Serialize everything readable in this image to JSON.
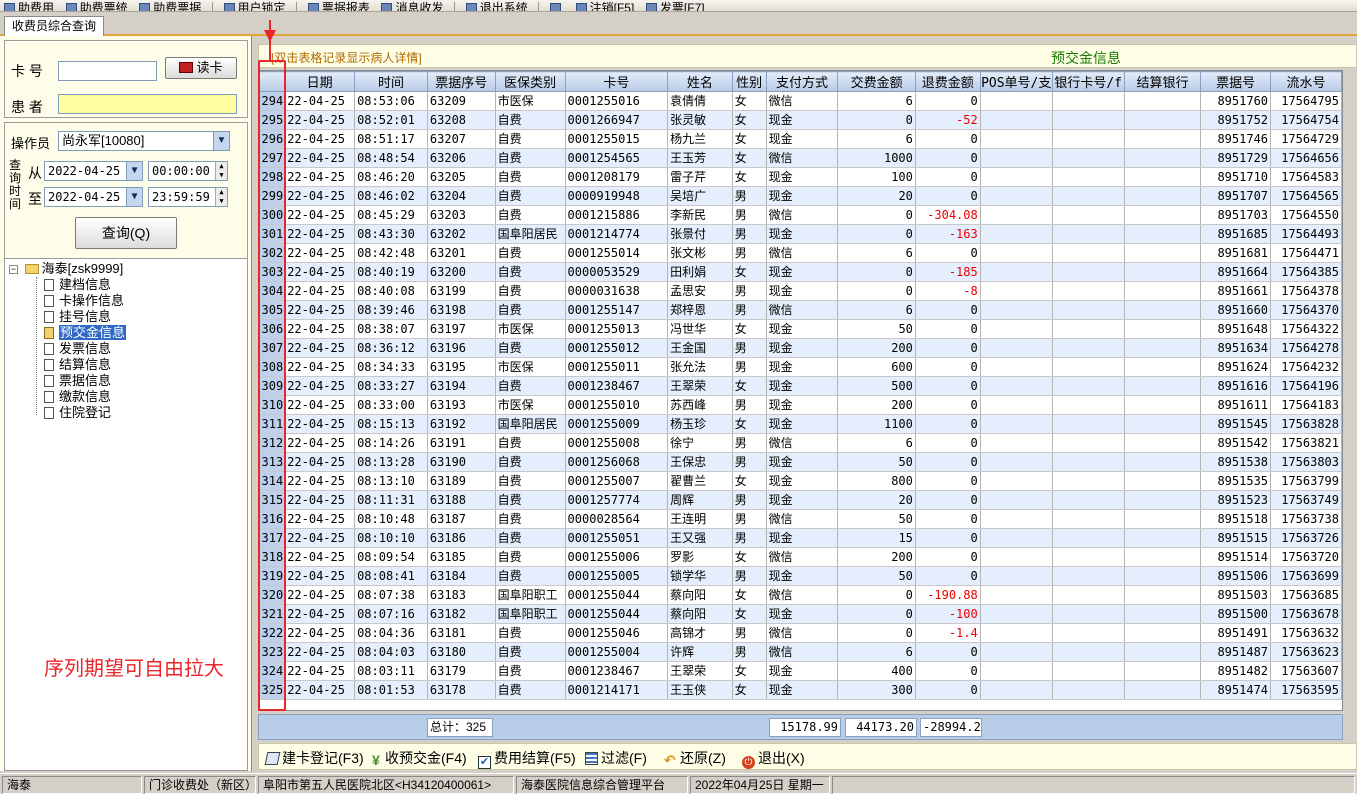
{
  "toolbar": {
    "items": [
      "助费用",
      "助费票统",
      "助费票据",
      "用户锁定",
      "票据报表",
      "消息收发",
      "退出系统",
      "",
      "注销[F5]",
      "发票[F7]"
    ]
  },
  "tabs": [
    {
      "label": "收费员综合查询"
    }
  ],
  "left": {
    "card_label": "卡  号",
    "card_value": "",
    "read_card_label": "读卡",
    "patient_label": "患  者",
    "patient_value": "",
    "operator_label": "操作员",
    "operator_value": "尚永军[10080]",
    "query_time_label": "查询时间",
    "from_label": "从",
    "to_label": "至",
    "from_date": "2022-04-25",
    "from_time": "00:00:00",
    "to_date": "2022-04-25",
    "to_time": "23:59:59",
    "query_button": "查询(Q)"
  },
  "tree": {
    "root": "海泰[zsk9999]",
    "items": [
      "建档信息",
      "卡操作信息",
      "挂号信息",
      "预交金信息",
      "发票信息",
      "结算信息",
      "票据信息",
      "缴款信息",
      "住院登记"
    ],
    "selected": "预交金信息"
  },
  "grid": {
    "hint": "[双击表格记录显示病人详情]",
    "title": "预交金信息",
    "columns": [
      "",
      "日期",
      "时间",
      "票据序号",
      "医保类别",
      "卡号",
      "姓名",
      "性别",
      "支付方式",
      "交费金额",
      "退费金额",
      "POS单号/支",
      "银行卡号/f",
      "结算银行",
      "票据号",
      "流水号"
    ],
    "rows": [
      [
        "294",
        "22-04-25",
        "08:53:06",
        "63209",
        "市医保",
        "0001255016",
        "袁倩倩",
        "女",
        "微信",
        "6",
        "0",
        "",
        "",
        "",
        "8951760",
        "17564795"
      ],
      [
        "295",
        "22-04-25",
        "08:52:01",
        "63208",
        "自费",
        "0001266947",
        "张灵敏",
        "女",
        "现金",
        "0",
        "-52",
        "",
        "",
        "",
        "8951752",
        "17564754"
      ],
      [
        "296",
        "22-04-25",
        "08:51:17",
        "63207",
        "自费",
        "0001255015",
        "杨九兰",
        "女",
        "现金",
        "6",
        "0",
        "",
        "",
        "",
        "8951746",
        "17564729"
      ],
      [
        "297",
        "22-04-25",
        "08:48:54",
        "63206",
        "自费",
        "0001254565",
        "王玉芳",
        "女",
        "微信",
        "1000",
        "0",
        "",
        "",
        "",
        "8951729",
        "17564656"
      ],
      [
        "298",
        "22-04-25",
        "08:46:20",
        "63205",
        "自费",
        "0001208179",
        "雷子芹",
        "女",
        "现金",
        "100",
        "0",
        "",
        "",
        "",
        "8951710",
        "17564583"
      ],
      [
        "299",
        "22-04-25",
        "08:46:02",
        "63204",
        "自费",
        "0000919948",
        "吴培广",
        "男",
        "现金",
        "20",
        "0",
        "",
        "",
        "",
        "8951707",
        "17564565"
      ],
      [
        "300",
        "22-04-25",
        "08:45:29",
        "63203",
        "自费",
        "0001215886",
        "李新民",
        "男",
        "微信",
        "0",
        "-304.08",
        "",
        "",
        "",
        "8951703",
        "17564550"
      ],
      [
        "301",
        "22-04-25",
        "08:43:30",
        "63202",
        "国阜阳居民",
        "0001214774",
        "张景付",
        "男",
        "现金",
        "0",
        "-163",
        "",
        "",
        "",
        "8951685",
        "17564493"
      ],
      [
        "302",
        "22-04-25",
        "08:42:48",
        "63201",
        "自费",
        "0001255014",
        "张文彬",
        "男",
        "微信",
        "6",
        "0",
        "",
        "",
        "",
        "8951681",
        "17564471"
      ],
      [
        "303",
        "22-04-25",
        "08:40:19",
        "63200",
        "自费",
        "0000053529",
        "田利娟",
        "女",
        "现金",
        "0",
        "-185",
        "",
        "",
        "",
        "8951664",
        "17564385"
      ],
      [
        "304",
        "22-04-25",
        "08:40:08",
        "63199",
        "自费",
        "0000031638",
        "孟思安",
        "男",
        "现金",
        "0",
        "-8",
        "",
        "",
        "",
        "8951661",
        "17564378"
      ],
      [
        "305",
        "22-04-25",
        "08:39:46",
        "63198",
        "自费",
        "0001255147",
        "郑梓恩",
        "男",
        "微信",
        "6",
        "0",
        "",
        "",
        "",
        "8951660",
        "17564370"
      ],
      [
        "306",
        "22-04-25",
        "08:38:07",
        "63197",
        "市医保",
        "0001255013",
        "冯世华",
        "女",
        "现金",
        "50",
        "0",
        "",
        "",
        "",
        "8951648",
        "17564322"
      ],
      [
        "307",
        "22-04-25",
        "08:36:12",
        "63196",
        "自费",
        "0001255012",
        "王金国",
        "男",
        "现金",
        "200",
        "0",
        "",
        "",
        "",
        "8951634",
        "17564278"
      ],
      [
        "308",
        "22-04-25",
        "08:34:33",
        "63195",
        "市医保",
        "0001255011",
        "张允法",
        "男",
        "现金",
        "600",
        "0",
        "",
        "",
        "",
        "8951624",
        "17564232"
      ],
      [
        "309",
        "22-04-25",
        "08:33:27",
        "63194",
        "自费",
        "0001238467",
        "王翠荣",
        "女",
        "现金",
        "500",
        "0",
        "",
        "",
        "",
        "8951616",
        "17564196"
      ],
      [
        "310",
        "22-04-25",
        "08:33:00",
        "63193",
        "市医保",
        "0001255010",
        "苏西峰",
        "男",
        "现金",
        "200",
        "0",
        "",
        "",
        "",
        "8951611",
        "17564183"
      ],
      [
        "311",
        "22-04-25",
        "08:15:13",
        "63192",
        "国阜阳居民",
        "0001255009",
        "杨玉珍",
        "女",
        "现金",
        "1100",
        "0",
        "",
        "",
        "",
        "8951545",
        "17563828"
      ],
      [
        "312",
        "22-04-25",
        "08:14:26",
        "63191",
        "自费",
        "0001255008",
        "徐宁",
        "男",
        "微信",
        "6",
        "0",
        "",
        "",
        "",
        "8951542",
        "17563821"
      ],
      [
        "313",
        "22-04-25",
        "08:13:28",
        "63190",
        "自费",
        "0001256068",
        "王保忠",
        "男",
        "现金",
        "50",
        "0",
        "",
        "",
        "",
        "8951538",
        "17563803"
      ],
      [
        "314",
        "22-04-25",
        "08:13:10",
        "63189",
        "自费",
        "0001255007",
        "翟曹兰",
        "女",
        "现金",
        "800",
        "0",
        "",
        "",
        "",
        "8951535",
        "17563799"
      ],
      [
        "315",
        "22-04-25",
        "08:11:31",
        "63188",
        "自费",
        "0001257774",
        "周辉",
        "男",
        "现金",
        "20",
        "0",
        "",
        "",
        "",
        "8951523",
        "17563749"
      ],
      [
        "316",
        "22-04-25",
        "08:10:48",
        "63187",
        "自费",
        "0000028564",
        "王连明",
        "男",
        "微信",
        "50",
        "0",
        "",
        "",
        "",
        "8951518",
        "17563738"
      ],
      [
        "317",
        "22-04-25",
        "08:10:10",
        "63186",
        "自费",
        "0001255051",
        "王又强",
        "男",
        "现金",
        "15",
        "0",
        "",
        "",
        "",
        "8951515",
        "17563726"
      ],
      [
        "318",
        "22-04-25",
        "08:09:54",
        "63185",
        "自费",
        "0001255006",
        "罗影",
        "女",
        "微信",
        "200",
        "0",
        "",
        "",
        "",
        "8951514",
        "17563720"
      ],
      [
        "319",
        "22-04-25",
        "08:08:41",
        "63184",
        "自费",
        "0001255005",
        "锁学华",
        "男",
        "现金",
        "50",
        "0",
        "",
        "",
        "",
        "8951506",
        "17563699"
      ],
      [
        "320",
        "22-04-25",
        "08:07:38",
        "63183",
        "国阜阳职工",
        "0001255044",
        "蔡向阳",
        "女",
        "微信",
        "0",
        "-190.88",
        "",
        "",
        "",
        "8951503",
        "17563685"
      ],
      [
        "321",
        "22-04-25",
        "08:07:16",
        "63182",
        "国阜阳职工",
        "0001255044",
        "蔡向阳",
        "女",
        "现金",
        "0",
        "-100",
        "",
        "",
        "",
        "8951500",
        "17563678"
      ],
      [
        "322",
        "22-04-25",
        "08:04:36",
        "63181",
        "自费",
        "0001255046",
        "高锦才",
        "男",
        "微信",
        "0",
        "-1.4",
        "",
        "",
        "",
        "8951491",
        "17563632"
      ],
      [
        "323",
        "22-04-25",
        "08:04:03",
        "63180",
        "自费",
        "0001255004",
        "许辉",
        "男",
        "微信",
        "6",
        "0",
        "",
        "",
        "",
        "8951487",
        "17563623"
      ],
      [
        "324",
        "22-04-25",
        "08:03:11",
        "63179",
        "自费",
        "0001238467",
        "王翠荣",
        "女",
        "现金",
        "400",
        "0",
        "",
        "",
        "",
        "8951482",
        "17563607"
      ],
      [
        "325",
        "22-04-25",
        "08:01:53",
        "63178",
        "自费",
        "0001214171",
        "王玉侠",
        "女",
        "现金",
        "300",
        "0",
        "",
        "",
        "",
        "8951474",
        "17563595"
      ]
    ],
    "footer": {
      "total_label": "总计：325",
      "sum1": "15178.99",
      "sum2": "44173.20",
      "sum3": "-28994.2"
    }
  },
  "actions": [
    "建卡登记(F3)",
    "收预交金(F4)",
    "费用结算(F5)",
    "过滤(F)",
    "还原(Z)",
    "退出(X)"
  ],
  "status": [
    "海泰",
    "门诊收费处（新区）",
    "阜阳市第五人民医院北区<H34120400061>",
    "海泰医院信息综合管理平台",
    "2022年04月25日 星期一"
  ],
  "annotation": "序列期望可自由拉大",
  "colors": {
    "accent_orange": "#e2a53b",
    "annotation_red": "#e8262b",
    "header_blue": "#b8cbe6",
    "negative_red": "#ee0000"
  }
}
